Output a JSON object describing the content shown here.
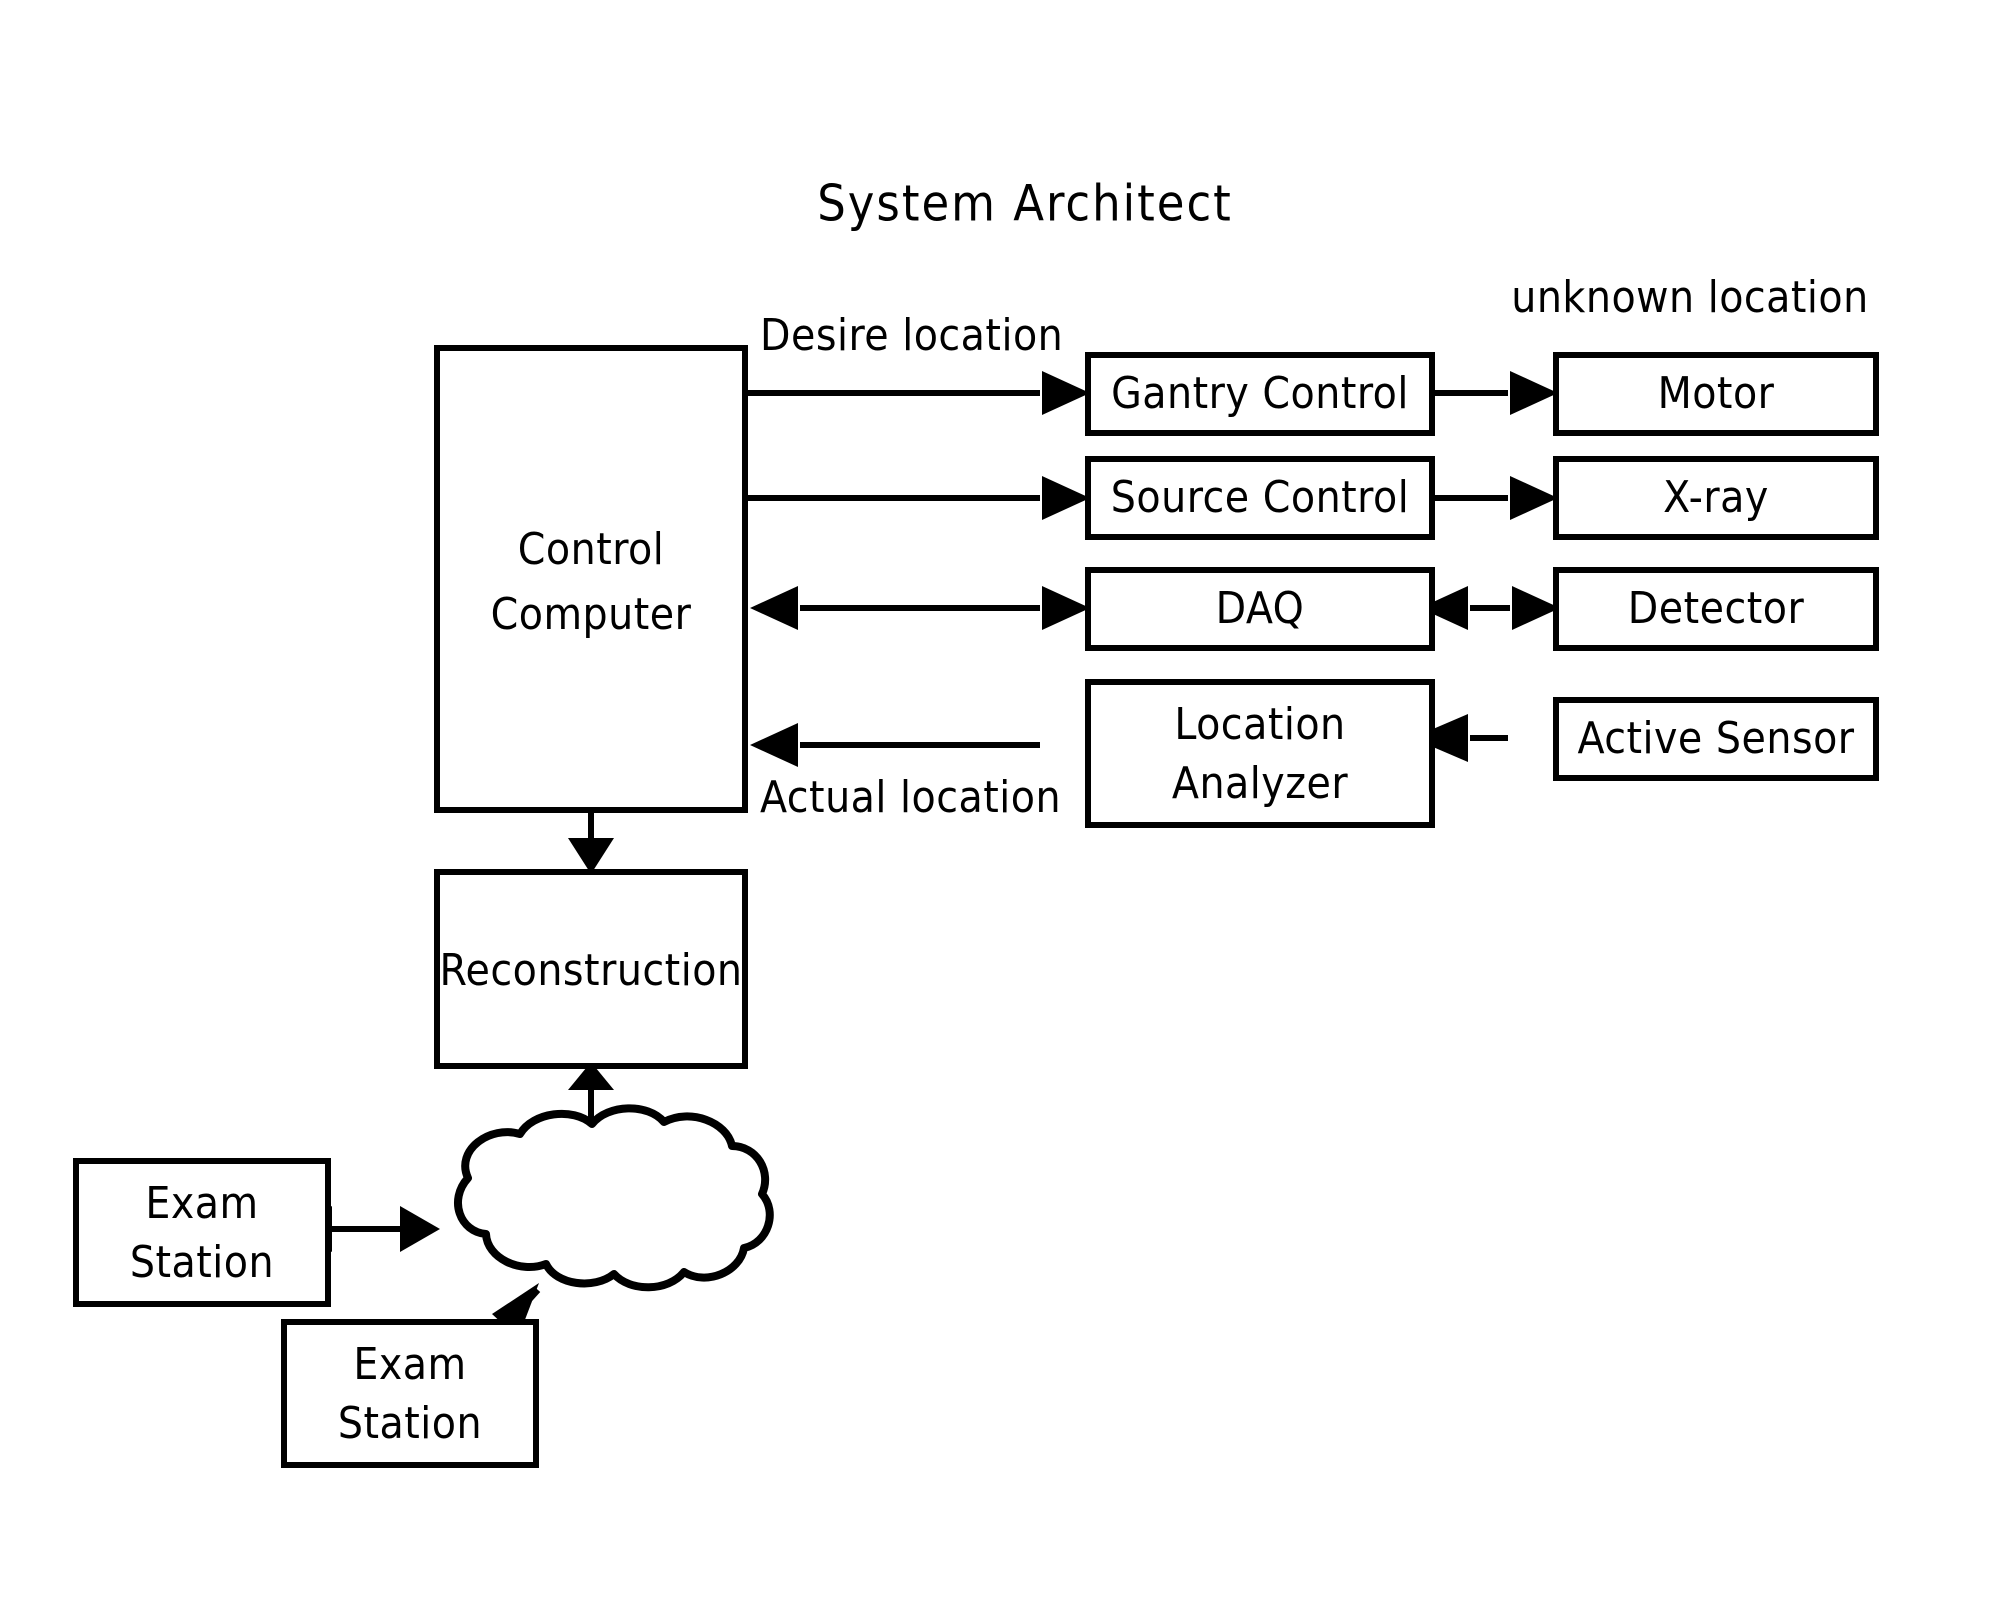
{
  "diagram": {
    "title": "System  Architect",
    "type": "block-diagram",
    "background_color": "#ffffff",
    "line_color": "#000000",
    "nodes": [
      {
        "id": "control-computer",
        "label_line1": "Control",
        "label_line2": "Computer",
        "shape": "rectangle"
      },
      {
        "id": "gantry-control",
        "label": "Gantry  Control",
        "shape": "rectangle"
      },
      {
        "id": "source-control",
        "label": "Source  Control",
        "shape": "rectangle"
      },
      {
        "id": "daq",
        "label": "DAQ",
        "shape": "rectangle"
      },
      {
        "id": "location-analyzer",
        "label_line1": "Location",
        "label_line2": "Analyzer",
        "shape": "rectangle"
      },
      {
        "id": "motor",
        "label": "Motor",
        "shape": "rectangle"
      },
      {
        "id": "xray",
        "label": "X-ray",
        "shape": "rectangle"
      },
      {
        "id": "detector",
        "label": "Detector",
        "shape": "rectangle"
      },
      {
        "id": "active-sensor",
        "label": "Active  Sensor",
        "shape": "rectangle"
      },
      {
        "id": "reconstruction",
        "label": "Reconstruction",
        "shape": "rectangle"
      },
      {
        "id": "network-cloud",
        "label": "",
        "shape": "cloud"
      },
      {
        "id": "exam-station-1",
        "label_line1": "Exam",
        "label_line2": "Station",
        "shape": "rectangle"
      },
      {
        "id": "exam-station-2",
        "label_line1": "Exam",
        "label_line2": "Station",
        "shape": "rectangle"
      }
    ],
    "edge_labels": {
      "desire_location": "Desire  location",
      "actual_location": "Actual  location",
      "unknown_location": "unknown location"
    },
    "edges": [
      {
        "from": "control-computer",
        "to": "gantry-control",
        "direction": "forward",
        "label": "Desire  location"
      },
      {
        "from": "gantry-control",
        "to": "motor",
        "direction": "forward"
      },
      {
        "from": "control-computer",
        "to": "source-control",
        "direction": "forward"
      },
      {
        "from": "source-control",
        "to": "xray",
        "direction": "forward"
      },
      {
        "from": "control-computer",
        "to": "daq",
        "direction": "both"
      },
      {
        "from": "daq",
        "to": "detector",
        "direction": "both"
      },
      {
        "from": "location-analyzer",
        "to": "control-computer",
        "direction": "forward",
        "label": "Actual  location"
      },
      {
        "from": "active-sensor",
        "to": "location-analyzer",
        "direction": "forward"
      },
      {
        "from": "control-computer",
        "to": "reconstruction",
        "direction": "forward"
      },
      {
        "from": "reconstruction",
        "to": "network-cloud",
        "direction": "both"
      },
      {
        "from": "exam-station-1",
        "to": "network-cloud",
        "direction": "both"
      },
      {
        "from": "exam-station-2",
        "to": "network-cloud",
        "direction": "both"
      }
    ]
  }
}
